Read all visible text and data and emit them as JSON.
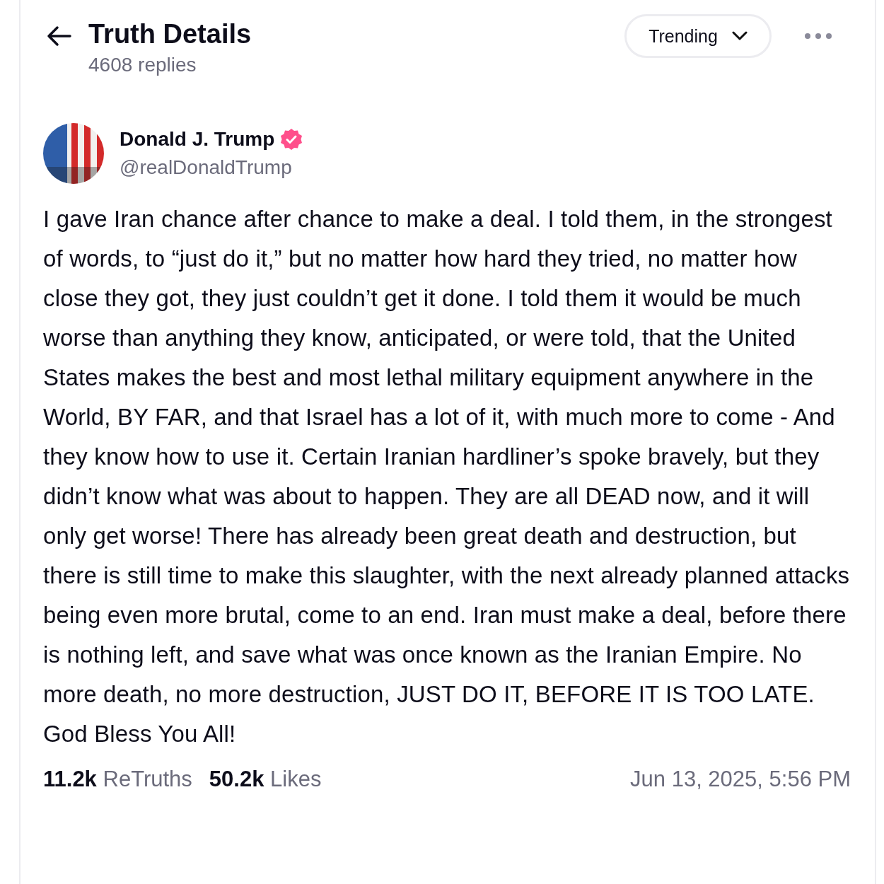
{
  "header": {
    "title": "Truth Details",
    "subtitle": "4608 replies",
    "sort": {
      "label": "Trending"
    }
  },
  "post": {
    "author": {
      "name": "Donald J. Trump",
      "handle": "@realDonaldTrump",
      "verified": true
    },
    "text": "I gave Iran chance after chance to make a deal. I told them, in the strongest of words, to “just do it,” but no matter how hard they tried, no matter how close they got, they just couldn’t get it done. I told them it would be much worse than anything they know, anticipated, or were told, that the United States makes the best and most lethal military equipment anywhere in the World, BY FAR, and that Israel has a lot of it, with much more to come - And they know how to use it. Certain Iranian hardliner’s spoke bravely, but they didn’t know what was about to happen. They are all DEAD now, and it will only get worse! There has already been great death and destruction, but there is still time to make this slaughter, with the next already planned attacks being even more brutal, come to an end. Iran must make a deal, before there is nothing left, and save what was once known as the Iranian Empire. No more death, no more destruction, JUST DO IT, BEFORE IT IS TOO LATE. God Bless You All!",
    "stats": [
      {
        "count": "11.2k",
        "label": "ReTruths"
      },
      {
        "count": "50.2k",
        "label": "Likes"
      }
    ],
    "timestamp": "Jun 13, 2025, 5:56 PM"
  }
}
